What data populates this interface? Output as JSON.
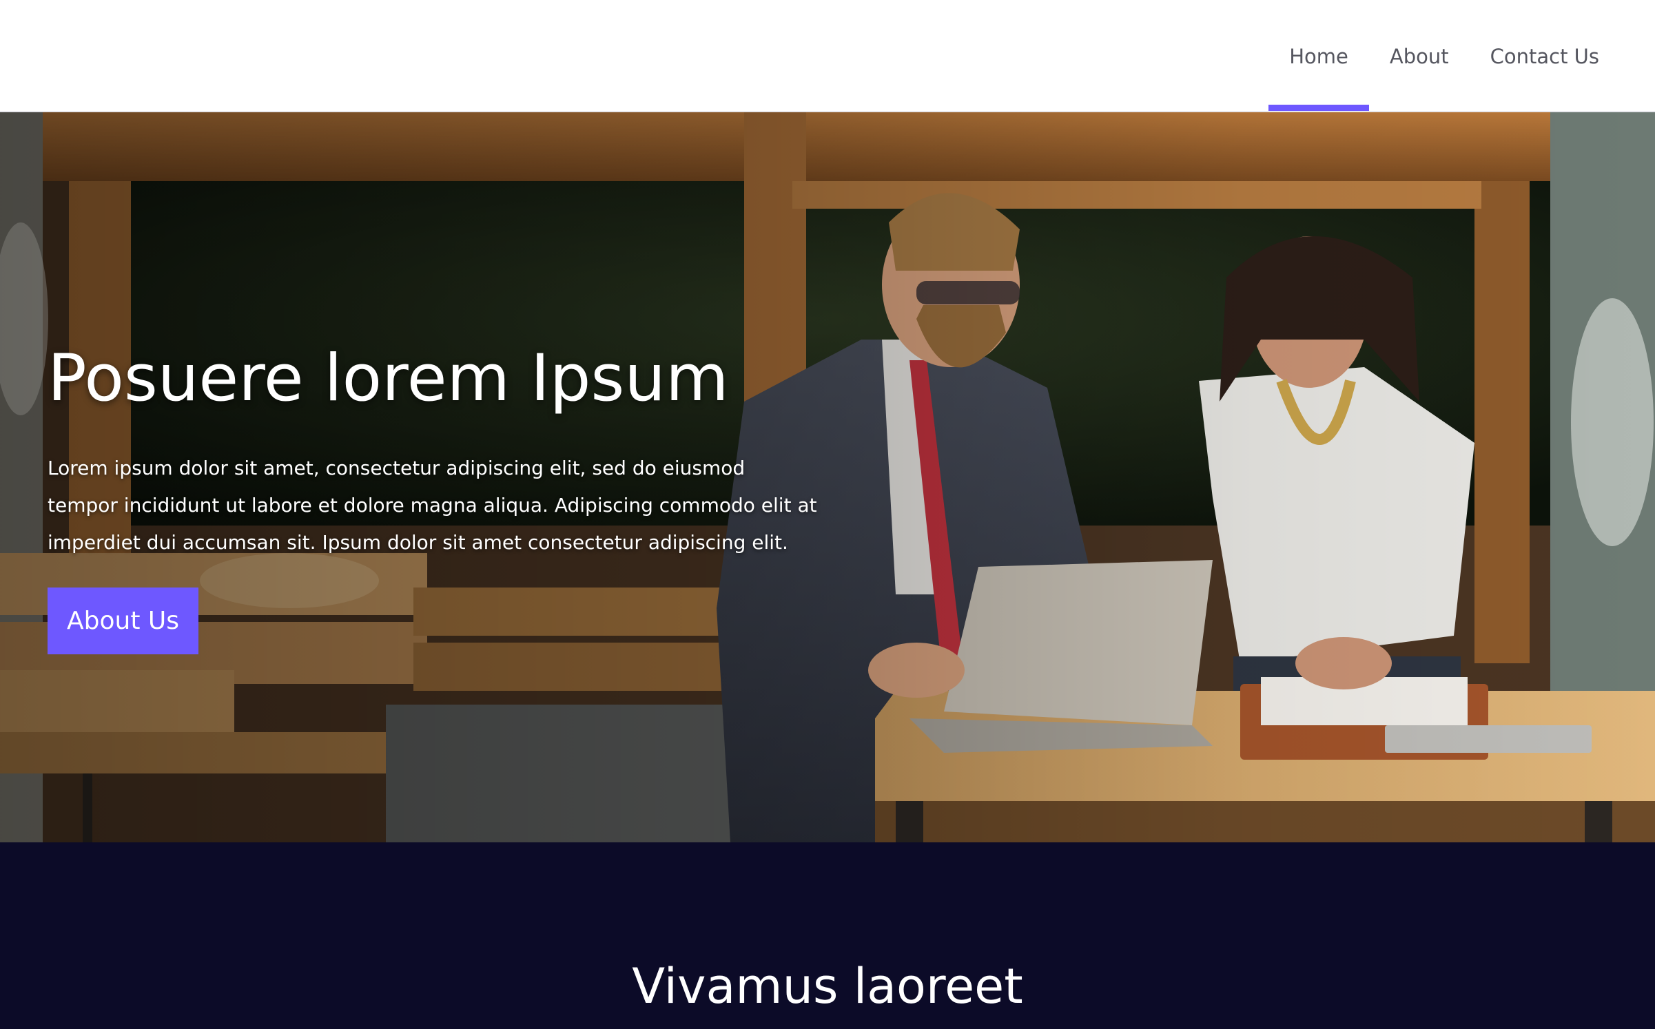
{
  "nav": {
    "items": [
      {
        "label": "Home",
        "active": true
      },
      {
        "label": "About",
        "active": false
      },
      {
        "label": "Contact Us",
        "active": false
      }
    ]
  },
  "hero": {
    "title": "Posuere lorem Ipsum",
    "text": "Lorem ipsum dolor sit amet, consectetur adipiscing elit, sed do eiusmod tempor incididunt ut labore et dolore magna aliqua. Adipiscing commodo elit at imperdiet dui accumsan sit. Ipsum dolor sit amet consectetur adipiscing elit.",
    "button_label": "About Us"
  },
  "section": {
    "title": "Vivamus laoreet"
  },
  "colors": {
    "accent": "#6e58ff",
    "dark_bg": "#0c0b28",
    "nav_text": "#55565f"
  }
}
